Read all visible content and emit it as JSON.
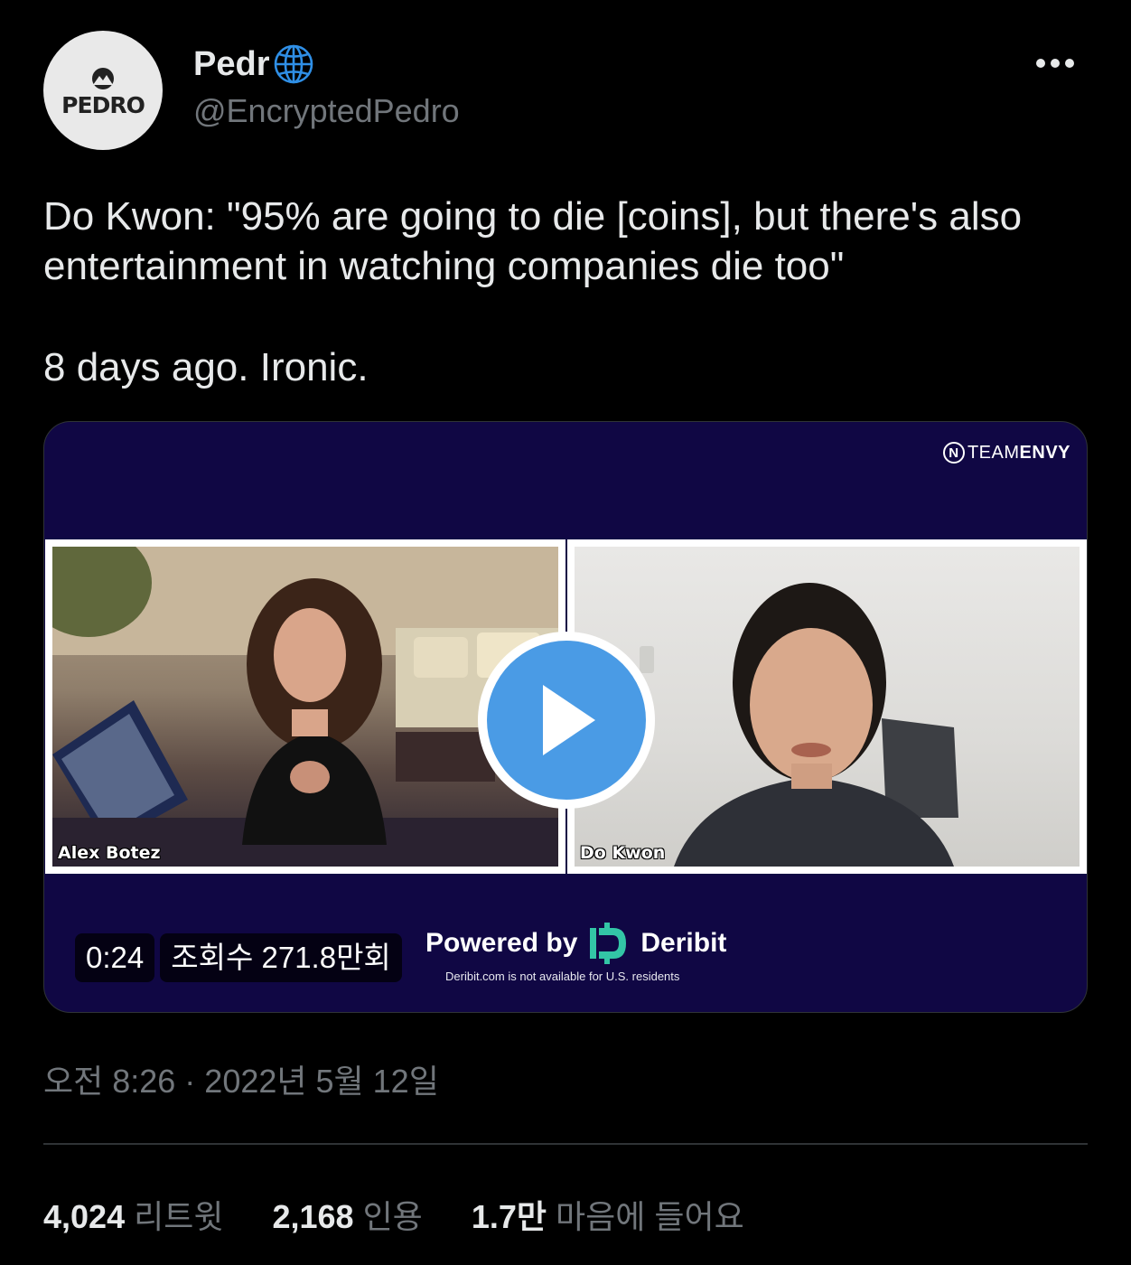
{
  "author": {
    "display_name": "Pedr",
    "handle": "@EncryptedPedro",
    "avatar_text": "PEDRO",
    "verified_icon": "globe-icon"
  },
  "tweet": {
    "line1": "Do Kwon: \"95% are going to die [coins], but there's also entertainment in watching companies die too\"",
    "line2": "8 days ago. Ironic."
  },
  "media": {
    "team_logo_a": "TEAM",
    "team_logo_b": "ENVY",
    "team_logo_icon": "N",
    "left_caption": "Alex Botez",
    "right_caption": "Do Kwon",
    "duration": "0:24",
    "views": "조회수 271.8만회",
    "sponsor_prefix": "Powered by",
    "sponsor_name": "Deribit",
    "sponsor_note": "Deribit.com is not available for U.S. residents",
    "background_color": "#100744",
    "play_color": "#4a9be5"
  },
  "timestamp": "오전 8:26 · 2022년 5월 12일",
  "stats": [
    {
      "value": "4,024",
      "label": "리트윗"
    },
    {
      "value": "2,168",
      "label": "인용"
    },
    {
      "value": "1.7만",
      "label": "마음에 들어요"
    }
  ]
}
